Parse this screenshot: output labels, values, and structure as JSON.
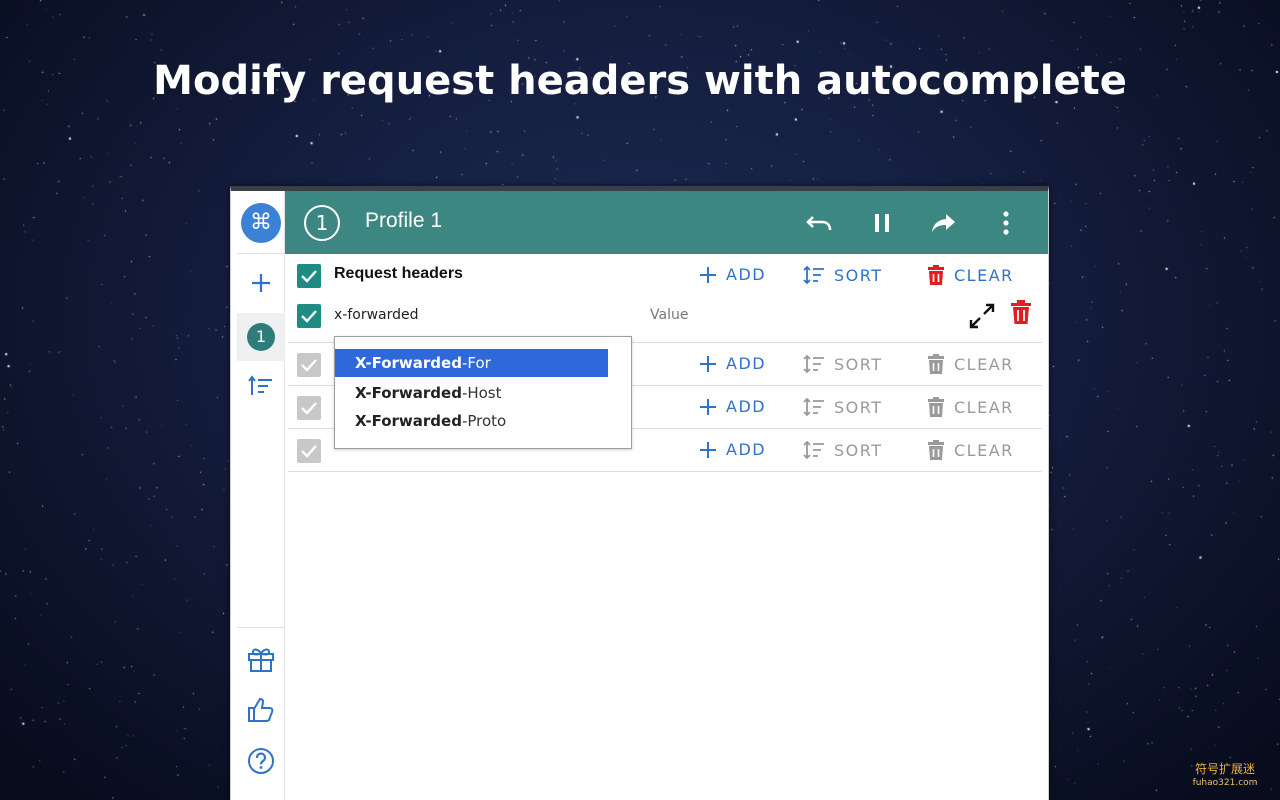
{
  "headline": "Modify request headers with autocomplete",
  "colors": {
    "accent": "#3c8782",
    "action_blue": "#2f73c9",
    "danger": "#e02020",
    "selection": "#2f68d8"
  },
  "sidebar": {
    "logo_icon": "command-icon",
    "add_icon": "plus-icon",
    "profile_badge": "1",
    "sort_icon": "sort-icon",
    "bottom_icons": [
      "gift-icon",
      "thumbs-up-icon",
      "help-icon"
    ]
  },
  "topbar": {
    "profile_number": "1",
    "profile_name": "Profile 1",
    "icons": [
      "undo-icon",
      "pause-icon",
      "share-icon",
      "more-vert-icon"
    ]
  },
  "actions": {
    "add": "ADD",
    "sort": "SORT",
    "clear": "CLEAR"
  },
  "request_headers": {
    "title": "Request headers",
    "checked": true,
    "header_row": {
      "name_value": "x-forwarded",
      "value_placeholder": "Value",
      "checked": true
    }
  },
  "autocomplete": {
    "match": "X-Forwarded",
    "options": [
      {
        "suffix": "-For",
        "selected": true
      },
      {
        "suffix": "-Host",
        "selected": false
      },
      {
        "suffix": "-Proto",
        "selected": false
      }
    ]
  },
  "watermark": {
    "text": "符号扩展迷",
    "sub": "fuhao321.com"
  }
}
